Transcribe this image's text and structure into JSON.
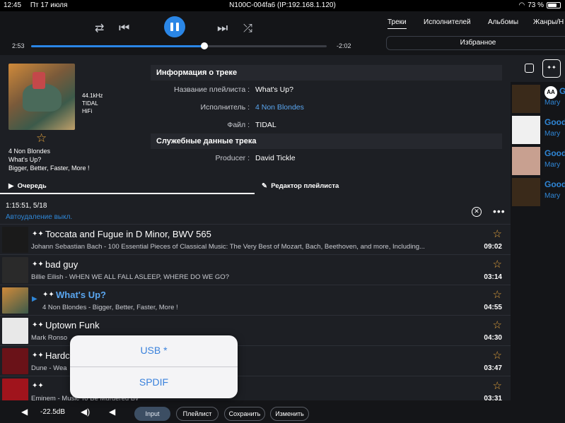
{
  "status_bar": {
    "time": "12:45",
    "date": "Пт 17 июля",
    "device": "N100C-004fa6 (IP:192.168.1.120)",
    "battery": "73 %",
    "battery_level": 0.73
  },
  "player": {
    "elapsed": "2:53",
    "remaining": "-2:02",
    "progress": 0.586
  },
  "nav_tabs": [
    "Треки",
    "Исполнителей",
    "Альбомы",
    "Жанры/Н"
  ],
  "favorites_label": "Избранное",
  "now_playing": {
    "quality": [
      "44.1kHz",
      "TIDAL",
      "HiFi"
    ],
    "artist": "4 Non Blondes",
    "title": "What's Up?",
    "album": "Bigger, Better, Faster, More !"
  },
  "track_info": {
    "header": "Информация о треке",
    "rows": [
      {
        "key": "Название плейлиста :",
        "value": "What's Up?"
      },
      {
        "key": "Исполнитель :",
        "value": "4 Non Blondes"
      },
      {
        "key": "Файл :",
        "value": "TIDAL"
      }
    ],
    "service_header": "Служебные данные трека",
    "service_rows": [
      {
        "key": "Producer :",
        "value": "David Tickle"
      }
    ]
  },
  "subtabs": {
    "queue": "Очередь",
    "editor": "Редактор плейлиста"
  },
  "queue": {
    "summary": "1:15:51, 5/18",
    "autodelete": "Автоудаление выкл.",
    "tracks": [
      {
        "title": "Toccata and Fugue in D Minor, BWV 565",
        "subtitle": "Johann Sebastian Bach - 100 Essential Pieces of Classical Music: The Very Best of Mozart, Bach, Beethoven, and more, Including...",
        "duration": "09:02",
        "cover_color": "#1a1a1a"
      },
      {
        "title": "bad guy",
        "subtitle": "Billie Eilish - WHEN WE ALL FALL ASLEEP, WHERE DO WE GO?",
        "duration": "03:14",
        "cover_color": "#2a2a2a"
      },
      {
        "title": "What's Up?",
        "subtitle": "4 Non Blondes - Bigger, Better, Faster, More !",
        "duration": "04:55",
        "cover_color": "#b06a34"
      },
      {
        "title": "Uptown Funk",
        "subtitle": "Mark Ronso",
        "duration": "04:30",
        "cover_color": "#e8e8e8"
      },
      {
        "title": "Hardc",
        "subtitle": "Dune - Wea",
        "duration": "03:47",
        "cover_color": "#6a1218"
      },
      {
        "title": "",
        "subtitle": "Eminem - Music To Be Murdered By",
        "duration": "03:31",
        "cover_color": "#a0141c"
      }
    ]
  },
  "bottom_bar": {
    "volume": "-22.5dB",
    "input": "Input",
    "playlist": "Плейлист",
    "save": "Сохранить",
    "edit": "Изменить"
  },
  "input_popup": {
    "options": [
      "USB *",
      "SPDIF"
    ]
  },
  "side_panel": {
    "items": [
      {
        "title": "G",
        "sub": "Mary",
        "cover": "#3a2a1a"
      },
      {
        "title": "Good",
        "sub": "Mary",
        "cover": "#f0f0f0"
      },
      {
        "title": "Good",
        "sub": "Mary",
        "cover": "#c8a090"
      },
      {
        "title": "Good",
        "sub": "Mary",
        "cover": "#3a2a1a"
      }
    ]
  },
  "colors": {
    "accent": "#2a86e6",
    "star": "#e6a43c",
    "link": "#5aa6f0"
  }
}
